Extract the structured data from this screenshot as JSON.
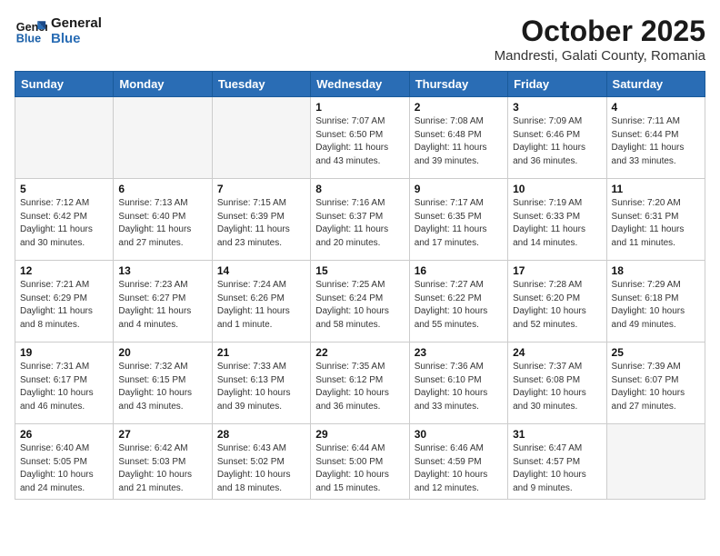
{
  "header": {
    "logo_line1": "General",
    "logo_line2": "Blue",
    "month_title": "October 2025",
    "location": "Mandresti, Galati County, Romania"
  },
  "weekdays": [
    "Sunday",
    "Monday",
    "Tuesday",
    "Wednesday",
    "Thursday",
    "Friday",
    "Saturday"
  ],
  "weeks": [
    [
      {
        "day": "",
        "info": ""
      },
      {
        "day": "",
        "info": ""
      },
      {
        "day": "",
        "info": ""
      },
      {
        "day": "1",
        "info": "Sunrise: 7:07 AM\nSunset: 6:50 PM\nDaylight: 11 hours\nand 43 minutes."
      },
      {
        "day": "2",
        "info": "Sunrise: 7:08 AM\nSunset: 6:48 PM\nDaylight: 11 hours\nand 39 minutes."
      },
      {
        "day": "3",
        "info": "Sunrise: 7:09 AM\nSunset: 6:46 PM\nDaylight: 11 hours\nand 36 minutes."
      },
      {
        "day": "4",
        "info": "Sunrise: 7:11 AM\nSunset: 6:44 PM\nDaylight: 11 hours\nand 33 minutes."
      }
    ],
    [
      {
        "day": "5",
        "info": "Sunrise: 7:12 AM\nSunset: 6:42 PM\nDaylight: 11 hours\nand 30 minutes."
      },
      {
        "day": "6",
        "info": "Sunrise: 7:13 AM\nSunset: 6:40 PM\nDaylight: 11 hours\nand 27 minutes."
      },
      {
        "day": "7",
        "info": "Sunrise: 7:15 AM\nSunset: 6:39 PM\nDaylight: 11 hours\nand 23 minutes."
      },
      {
        "day": "8",
        "info": "Sunrise: 7:16 AM\nSunset: 6:37 PM\nDaylight: 11 hours\nand 20 minutes."
      },
      {
        "day": "9",
        "info": "Sunrise: 7:17 AM\nSunset: 6:35 PM\nDaylight: 11 hours\nand 17 minutes."
      },
      {
        "day": "10",
        "info": "Sunrise: 7:19 AM\nSunset: 6:33 PM\nDaylight: 11 hours\nand 14 minutes."
      },
      {
        "day": "11",
        "info": "Sunrise: 7:20 AM\nSunset: 6:31 PM\nDaylight: 11 hours\nand 11 minutes."
      }
    ],
    [
      {
        "day": "12",
        "info": "Sunrise: 7:21 AM\nSunset: 6:29 PM\nDaylight: 11 hours\nand 8 minutes."
      },
      {
        "day": "13",
        "info": "Sunrise: 7:23 AM\nSunset: 6:27 PM\nDaylight: 11 hours\nand 4 minutes."
      },
      {
        "day": "14",
        "info": "Sunrise: 7:24 AM\nSunset: 6:26 PM\nDaylight: 11 hours\nand 1 minute."
      },
      {
        "day": "15",
        "info": "Sunrise: 7:25 AM\nSunset: 6:24 PM\nDaylight: 10 hours\nand 58 minutes."
      },
      {
        "day": "16",
        "info": "Sunrise: 7:27 AM\nSunset: 6:22 PM\nDaylight: 10 hours\nand 55 minutes."
      },
      {
        "day": "17",
        "info": "Sunrise: 7:28 AM\nSunset: 6:20 PM\nDaylight: 10 hours\nand 52 minutes."
      },
      {
        "day": "18",
        "info": "Sunrise: 7:29 AM\nSunset: 6:18 PM\nDaylight: 10 hours\nand 49 minutes."
      }
    ],
    [
      {
        "day": "19",
        "info": "Sunrise: 7:31 AM\nSunset: 6:17 PM\nDaylight: 10 hours\nand 46 minutes."
      },
      {
        "day": "20",
        "info": "Sunrise: 7:32 AM\nSunset: 6:15 PM\nDaylight: 10 hours\nand 43 minutes."
      },
      {
        "day": "21",
        "info": "Sunrise: 7:33 AM\nSunset: 6:13 PM\nDaylight: 10 hours\nand 39 minutes."
      },
      {
        "day": "22",
        "info": "Sunrise: 7:35 AM\nSunset: 6:12 PM\nDaylight: 10 hours\nand 36 minutes."
      },
      {
        "day": "23",
        "info": "Sunrise: 7:36 AM\nSunset: 6:10 PM\nDaylight: 10 hours\nand 33 minutes."
      },
      {
        "day": "24",
        "info": "Sunrise: 7:37 AM\nSunset: 6:08 PM\nDaylight: 10 hours\nand 30 minutes."
      },
      {
        "day": "25",
        "info": "Sunrise: 7:39 AM\nSunset: 6:07 PM\nDaylight: 10 hours\nand 27 minutes."
      }
    ],
    [
      {
        "day": "26",
        "info": "Sunrise: 6:40 AM\nSunset: 5:05 PM\nDaylight: 10 hours\nand 24 minutes."
      },
      {
        "day": "27",
        "info": "Sunrise: 6:42 AM\nSunset: 5:03 PM\nDaylight: 10 hours\nand 21 minutes."
      },
      {
        "day": "28",
        "info": "Sunrise: 6:43 AM\nSunset: 5:02 PM\nDaylight: 10 hours\nand 18 minutes."
      },
      {
        "day": "29",
        "info": "Sunrise: 6:44 AM\nSunset: 5:00 PM\nDaylight: 10 hours\nand 15 minutes."
      },
      {
        "day": "30",
        "info": "Sunrise: 6:46 AM\nSunset: 4:59 PM\nDaylight: 10 hours\nand 12 minutes."
      },
      {
        "day": "31",
        "info": "Sunrise: 6:47 AM\nSunset: 4:57 PM\nDaylight: 10 hours\nand 9 minutes."
      },
      {
        "day": "",
        "info": ""
      }
    ]
  ]
}
